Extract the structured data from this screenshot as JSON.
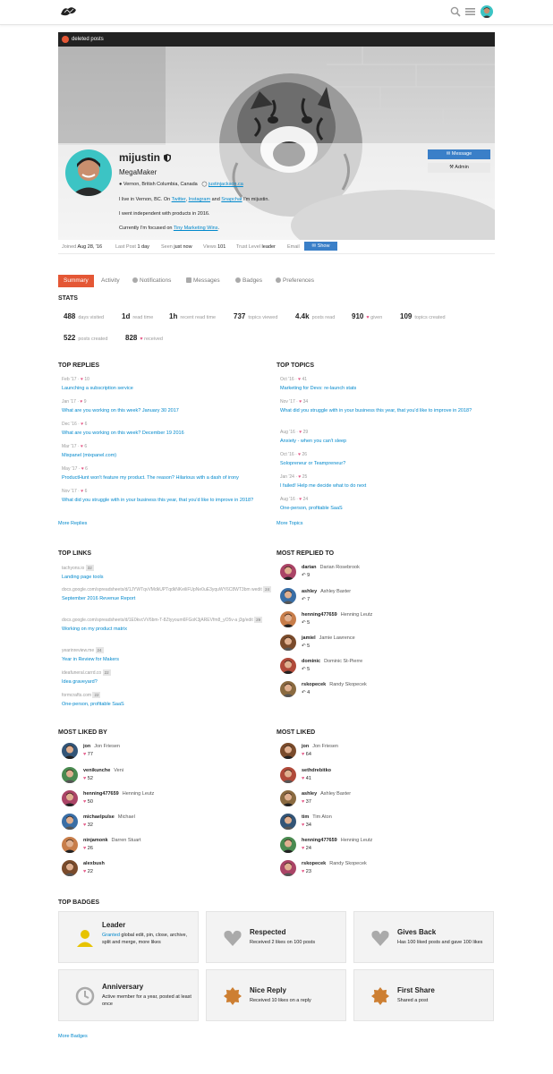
{
  "header": {
    "logo": "MegaMaker",
    "icons": {
      "search": "search-icon",
      "menu": "hamburger-icon",
      "avatar": "avatar"
    }
  },
  "profile": {
    "deleted_posts": "deleted posts",
    "username": "mijustin",
    "title": "MegaMaker",
    "location": "Vernon, British Columbia, Canada",
    "website": "justinjackson.ca",
    "bio_line1_prefix": "I live in Vernon, BC. On",
    "bio_twitter": "Twitter",
    "bio_comma": ",",
    "bio_instagram": "Instagram",
    "bio_and": "and",
    "bio_snapchat": "Snapchat",
    "bio_line1_suffix": "I'm mijustin.",
    "bio_line2": "I went independent with products in 2016.",
    "bio_line3_prefix": "Currently I'm focused on",
    "bio_line3_link": "Tiny Marketing Wins",
    "bio_line3_suffix": ".",
    "message_label": "Message",
    "admin_label": "Admin"
  },
  "meta": {
    "joined_label": "Joined",
    "joined_value": "Aug 28, '16",
    "lastpost_label": "Last Post",
    "lastpost_value": "1 day",
    "seen_label": "Seen",
    "seen_value": "just now",
    "views_label": "Views",
    "views_value": "101",
    "trust_label": "Trust Level",
    "trust_value": "leader",
    "email_label": "Email",
    "show_label": "Show"
  },
  "nav": {
    "tabs": [
      "Summary",
      "Activity",
      "Notifications",
      "Messages",
      "Badges",
      "Preferences"
    ]
  },
  "stats": {
    "heading": "STATS",
    "items": [
      {
        "value": "488",
        "label": "days visited"
      },
      {
        "value": "1d",
        "label": "read time"
      },
      {
        "value": "1h",
        "label": "recent read time"
      },
      {
        "value": "737",
        "label": "topics viewed"
      },
      {
        "value": "4.4k",
        "label": "posts read"
      },
      {
        "value": "910",
        "label": "given"
      },
      {
        "value": "109",
        "label": "topics created"
      },
      {
        "value": "522",
        "label": "posts created"
      },
      {
        "value": "828",
        "label": "received"
      }
    ]
  },
  "top_replies": {
    "heading": "TOP REPLIES",
    "more": "More Replies",
    "items": [
      {
        "date": "Feb '17",
        "likes": "10",
        "title": "Launching a subscription service"
      },
      {
        "date": "Jan '17",
        "likes": "9",
        "title": "What are you working on this week? January 30 2017"
      },
      {
        "date": "Dec '16",
        "likes": "6",
        "title": "What are you working on this week? December 19 2016"
      },
      {
        "date": "Mar '17",
        "likes": "6",
        "title": "Mixpanel (mixpanel.com)"
      },
      {
        "date": "May '17",
        "likes": "6",
        "title": "ProductHunt won't feature my product. The reason? Hilarious with a dash of irony"
      },
      {
        "date": "Nov '17",
        "likes": "6",
        "title": "What did you struggle with in your business this year, that you'd like to improve in 2018?"
      }
    ]
  },
  "top_topics": {
    "heading": "TOP TOPICS",
    "more": "More Topics",
    "items": [
      {
        "date": "Oct '16",
        "likes": "41",
        "title": "Marketing for Devs: re-launch stats"
      },
      {
        "date": "Nov '17",
        "likes": "34",
        "title": "What did you struggle with in your business this year, that you'd like to improve in 2018?"
      },
      {
        "date": "Aug '16",
        "likes": "29",
        "title": "Anxiety - when you can't sleep"
      },
      {
        "date": "Oct '16",
        "likes": "26",
        "title": "Solopreneur or Teampreneur?"
      },
      {
        "date": "Jan '24",
        "likes": "25",
        "title": "I failed! Help me decide what to do next"
      },
      {
        "date": "Aug '16",
        "likes": "24",
        "title": "One-person, profitable SaaS"
      }
    ]
  },
  "top_links": {
    "heading": "TOP LINKS",
    "items": [
      {
        "domain": "tachyons.io",
        "count": "32",
        "title": "Landing page tools"
      },
      {
        "domain": "docs.google.com/spreadsheets/d/1JYWTqvVMdkUPTqdkNKeiliFUpNe0uE3yquWY6C8WT3bm wedit",
        "count": "24",
        "title": "September 2016 Revenue Report"
      },
      {
        "domain": "docs.google.com/spreadsheets/d/1E0kvcVV6bm-T-8Ztyyoum6FGoK3jAREVfm8_yO5v-a j3g/edit",
        "count": "29",
        "title": "Working on my product matrix"
      },
      {
        "domain": "yearinreview.me",
        "count": "24",
        "title": "Year in Review for Makers"
      },
      {
        "domain": "ideafuneral.carrd.co",
        "count": "22",
        "title": "Idea graveyard?"
      },
      {
        "domain": "formcrafts.com",
        "count": "22",
        "title": "One-person, profitable SaaS"
      }
    ]
  },
  "most_replied_to": {
    "heading": "MOST REPLIED TO",
    "items": [
      {
        "user": "darian",
        "name": "Darian Rosebrook",
        "count": "9"
      },
      {
        "user": "ashley",
        "name": "Ashley Baxter",
        "count": "7"
      },
      {
        "user": "henning477659",
        "name": "Henning Leutz",
        "count": "5"
      },
      {
        "user": "jamiel",
        "name": "Jamie Lawrence",
        "count": "5"
      },
      {
        "user": "dominic",
        "name": "Dominic St-Pierre",
        "count": "5"
      },
      {
        "user": "rskopecek",
        "name": "Randy Skopecek",
        "count": "4"
      }
    ]
  },
  "most_liked_by": {
    "heading": "MOST LIKED BY",
    "items": [
      {
        "user": "jon",
        "name": "Jon Friesen",
        "count": "77"
      },
      {
        "user": "venikunche",
        "name": "Veni",
        "count": "52"
      },
      {
        "user": "henning477659",
        "name": "Henning Leutz",
        "count": "50"
      },
      {
        "user": "michaelpulse",
        "name": "Michael",
        "count": "32"
      },
      {
        "user": "ninjamonk",
        "name": "Darren Stuart",
        "count": "26"
      },
      {
        "user": "alexbush",
        "name": "",
        "count": "22"
      }
    ]
  },
  "most_liked": {
    "heading": "MOST LIKED",
    "items": [
      {
        "user": "jon",
        "name": "Jon Friesen",
        "count": "64"
      },
      {
        "user": "sethdrebitko",
        "name": "",
        "count": "41"
      },
      {
        "user": "ashley",
        "name": "Ashley Baxter",
        "count": "37"
      },
      {
        "user": "tim",
        "name": "Tim Aton",
        "count": "34"
      },
      {
        "user": "henning477659",
        "name": "Henning Leutz",
        "count": "24"
      },
      {
        "user": "rskopecek",
        "name": "Randy Skopecek",
        "count": "23"
      }
    ]
  },
  "top_badges": {
    "heading": "TOP BADGES",
    "more": "More Badges",
    "items": [
      {
        "name": "Leader",
        "desc_link": "Granted",
        "desc": "global edit, pin, close, archive, split and merge, more likes",
        "icon": "user-icon",
        "color": "#e7c300"
      },
      {
        "name": "Respected",
        "desc_link": "",
        "desc": "Received 2 likes on 100 posts",
        "icon": "heart-icon",
        "color": "#aaaaaa"
      },
      {
        "name": "Gives Back",
        "desc_link": "",
        "desc": "Has 100 liked posts and gave 100 likes",
        "icon": "heart-icon",
        "color": "#aaaaaa"
      },
      {
        "name": "Anniversary",
        "desc_link": "",
        "desc": "Active member for a year, posted at least once",
        "icon": "clock-icon",
        "color": "#aaaaaa"
      },
      {
        "name": "Nice Reply",
        "desc_link": "",
        "desc": "Received 10 likes on a reply",
        "icon": "certificate-icon",
        "color": "#cd7f32"
      },
      {
        "name": "First Share",
        "desc_link": "",
        "desc": "Shared a post",
        "icon": "certificate-icon",
        "color": "#cd7f32"
      }
    ]
  },
  "colors": {
    "accent": "#e45735",
    "link": "#0088cc",
    "primary_button": "#3a7fc8",
    "heart": "#e45786"
  }
}
